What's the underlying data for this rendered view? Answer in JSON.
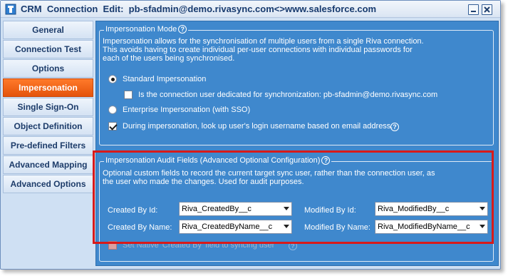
{
  "window": {
    "title": "CRM  Connection  Edit:  pb-sfadmin@demo.rivasync.com<>www.salesforce.com"
  },
  "sidebar": {
    "items": [
      {
        "label": "General",
        "active": false
      },
      {
        "label": "Connection Test",
        "active": false
      },
      {
        "label": "Options",
        "active": false
      },
      {
        "label": "Impersonation",
        "active": true
      },
      {
        "label": "Single Sign-On",
        "active": false
      },
      {
        "label": "Object Definition",
        "active": false
      },
      {
        "label": "Pre-defined Filters",
        "active": false
      },
      {
        "label": "Advanced Mapping",
        "active": false
      },
      {
        "label": "Advanced Options",
        "active": false
      }
    ]
  },
  "impersonation_mode": {
    "legend": "Impersonation Mode",
    "description": "Impersonation allows for the synchronisation of multiple users from a single Riva connection.\nThis avoids having to create individual per-user connections with individual passwords for\neach of the users being synchronised.",
    "standard_label": "Standard Impersonation",
    "standard_selected": true,
    "dedicated_label": "Is the connection user dedicated for synchronization: pb-sfadmin@demo.rivasync.com",
    "dedicated_checked": false,
    "enterprise_label": "Enterprise Impersonation (with SSO)",
    "enterprise_selected": false,
    "lookup_label": "During impersonation, look up user's login username based on email address.",
    "lookup_checked": true
  },
  "audit_fields": {
    "legend": "Impersonation Audit Fields (Advanced Optional Configuration)",
    "description": "Optional custom fields to record the current target sync user, rather than the connection user, as\nthe user who made the changes.  Used for audit purposes.",
    "created_by_id_label": "Created By Id:",
    "created_by_id_value": "Riva_CreatedBy__c",
    "modified_by_id_label": "Modified By Id:",
    "modified_by_id_value": "Riva_ModifiedBy__c",
    "created_by_name_label": "Created By Name:",
    "created_by_name_value": "Riva_CreatedByName__c",
    "modified_by_name_label": "Modified By Name:",
    "modified_by_name_value": "Riva_ModifiedByName__c",
    "native_label": "Set Native 'Created By' field to syncing user",
    "native_checked": false
  },
  "colors": {
    "accent_orange": "#e4530b",
    "panel_blue": "#3f88cd",
    "highlight_red": "#d81a1a"
  },
  "icons": {
    "app": "crm-app-icon",
    "help": "help-icon",
    "minimize": "minimize-icon",
    "close": "close-icon"
  }
}
